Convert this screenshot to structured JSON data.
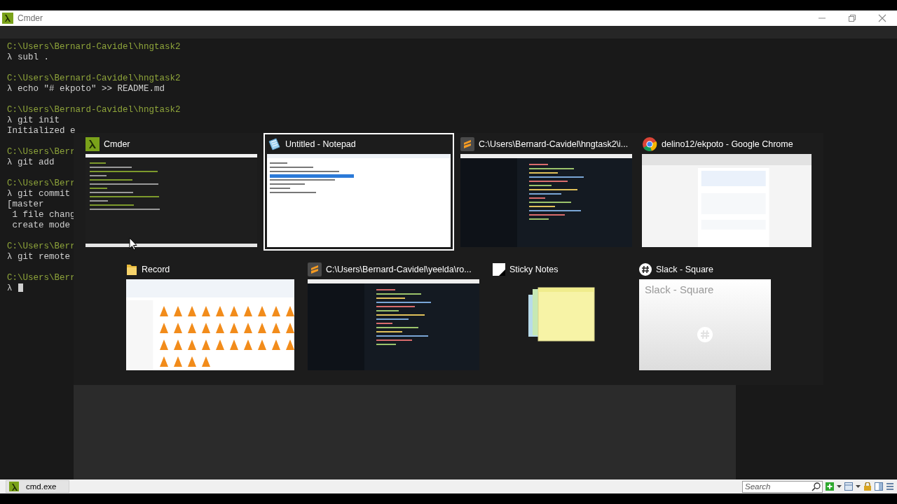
{
  "window": {
    "title": "Cmder"
  },
  "terminal": {
    "lines": [
      {
        "kind": "path",
        "text": "C:\\Users\\Bernard-Cavidel\\hngtask2"
      },
      {
        "kind": "command",
        "text": "λ subl ."
      },
      {
        "kind": "blank"
      },
      {
        "kind": "path",
        "text": "C:\\Users\\Bernard-Cavidel\\hngtask2"
      },
      {
        "kind": "command",
        "text": "λ echo \"# ekpoto\" >> README.md"
      },
      {
        "kind": "blank"
      },
      {
        "kind": "path",
        "text": "C:\\Users\\Bernard-Cavidel\\hngtask2"
      },
      {
        "kind": "command",
        "text": "λ git init"
      },
      {
        "kind": "output",
        "text": "Initialized e"
      },
      {
        "kind": "blank"
      },
      {
        "kind": "path",
        "text": "C:\\Users\\Berr"
      },
      {
        "kind": "command",
        "text": "λ git add"
      },
      {
        "kind": "blank"
      },
      {
        "kind": "path",
        "text": "C:\\Users\\Berr"
      },
      {
        "kind": "command",
        "text": "λ git commit"
      },
      {
        "kind": "output",
        "text": "[master"
      },
      {
        "kind": "output",
        "text": " 1 file chang"
      },
      {
        "kind": "output",
        "text": " create mode"
      },
      {
        "kind": "blank"
      },
      {
        "kind": "path",
        "text": "C:\\Users\\Berr"
      },
      {
        "kind": "command",
        "text": "λ git remote"
      },
      {
        "kind": "blank"
      },
      {
        "kind": "path",
        "text": "C:\\Users\\Berr"
      },
      {
        "kind": "prompt",
        "text": "λ"
      }
    ]
  },
  "switcher": {
    "rows": [
      {
        "windows": [
          {
            "title": "Cmder",
            "kind": "terminal",
            "selected": false
          },
          {
            "title": "Untitled - Notepad",
            "kind": "notepad",
            "selected": true
          },
          {
            "title": "C:\\Users\\Bernard-Cavidel\\hngtask2\\i...",
            "kind": "editor",
            "selected": false
          },
          {
            "title": "delino12/ekpoto - Google Chrome",
            "kind": "browser",
            "selected": false
          }
        ]
      },
      {
        "windows": [
          {
            "title": "Record",
            "kind": "explorer",
            "selected": false
          },
          {
            "title": "C:\\Users\\Bernard-Cavidel\\yeelda\\ro...",
            "kind": "editor",
            "selected": false
          },
          {
            "title": "Sticky Notes",
            "kind": "notes",
            "selected": false
          },
          {
            "title": "Slack - Square",
            "kind": "chat",
            "selected": false,
            "preview_text": "Slack - Square"
          }
        ]
      }
    ]
  },
  "status_bar": {
    "tabs": [
      {
        "label": "cmd.exe",
        "selected": true
      }
    ],
    "search": {
      "placeholder": "Search"
    }
  }
}
